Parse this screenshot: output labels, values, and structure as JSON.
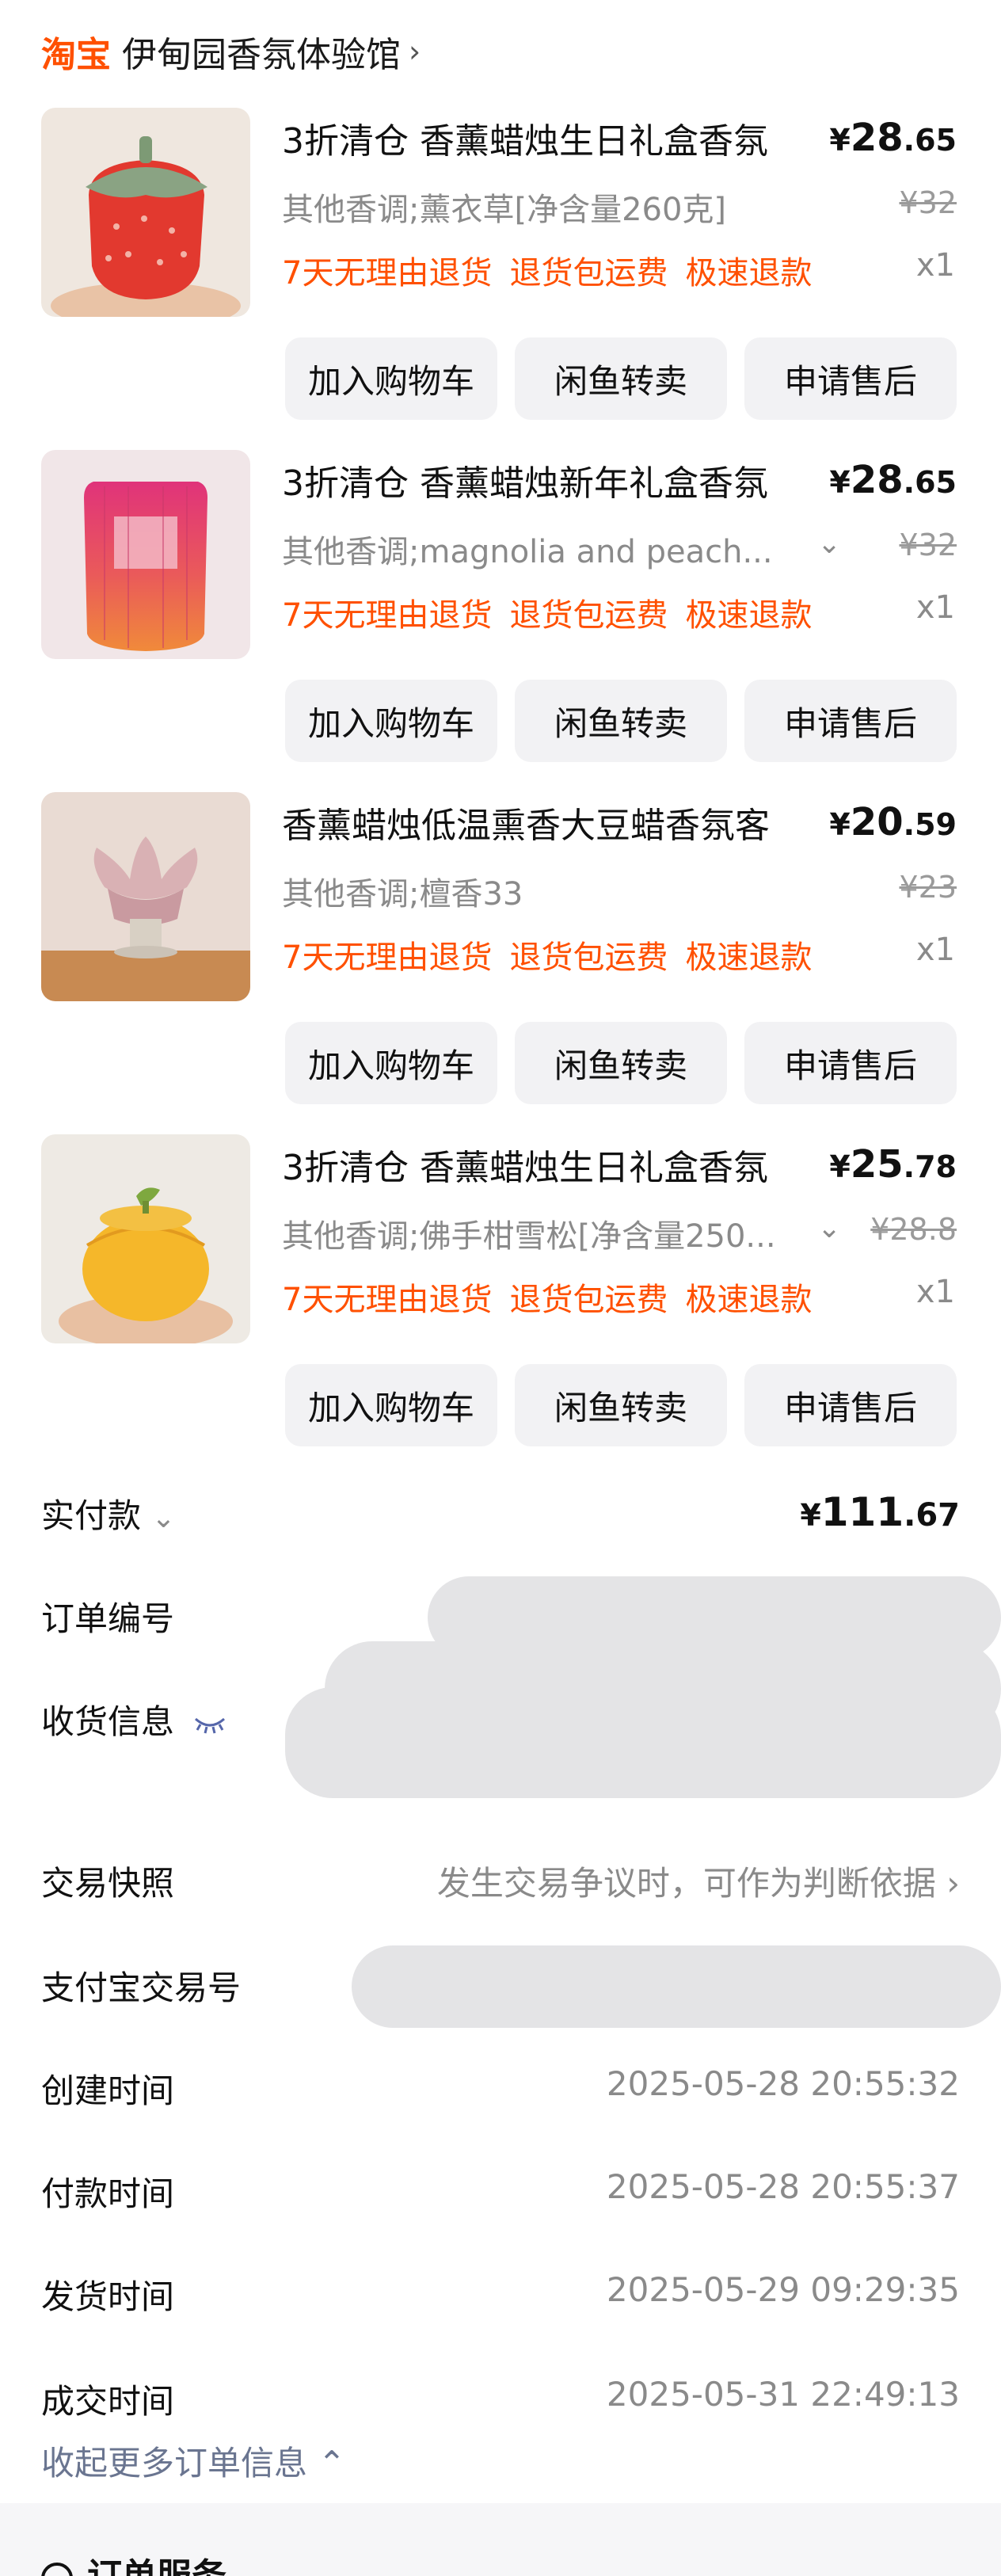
{
  "shop": {
    "brand": "淘宝",
    "name": "伊甸园香氛体验馆",
    "chevron": "›"
  },
  "items": [
    {
      "title": "3折清仓 香薰蜡烛生日礼盒香氛",
      "price_symbol": "¥",
      "price_int": "28",
      "price_dec": ".65",
      "sku": "其他香调;薰衣草[净含量260克]",
      "has_sku_chevron": false,
      "sku_chevron": "",
      "orig_price": "¥32",
      "tags": [
        "7天无理由退货",
        "退货包运费",
        "极速退款"
      ],
      "qty": "x1",
      "buttons": [
        "加入购物车",
        "闲鱼转卖",
        "申请售后"
      ]
    },
    {
      "title": "3折清仓 香薰蜡烛新年礼盒香氛",
      "price_symbol": "¥",
      "price_int": "28",
      "price_dec": ".65",
      "sku": "其他香调;magnolia and peach...",
      "has_sku_chevron": true,
      "sku_chevron": "⌄",
      "orig_price": "¥32",
      "tags": [
        "7天无理由退货",
        "退货包运费",
        "极速退款"
      ],
      "qty": "x1",
      "buttons": [
        "加入购物车",
        "闲鱼转卖",
        "申请售后"
      ]
    },
    {
      "title": "香薰蜡烛低温熏香大豆蜡香氛客",
      "price_symbol": "¥",
      "price_int": "20",
      "price_dec": ".59",
      "sku": "其他香调;檀香33",
      "has_sku_chevron": false,
      "sku_chevron": "",
      "orig_price": "¥23",
      "tags": [
        "7天无理由退货",
        "退货包运费",
        "极速退款"
      ],
      "qty": "x1",
      "buttons": [
        "加入购物车",
        "闲鱼转卖",
        "申请售后"
      ]
    },
    {
      "title": "3折清仓 香薰蜡烛生日礼盒香氛",
      "price_symbol": "¥",
      "price_int": "25",
      "price_dec": ".78",
      "sku": "其他香调;佛手柑雪松[净含量250...",
      "has_sku_chevron": true,
      "sku_chevron": "⌄",
      "orig_price": "¥28.8",
      "tags": [
        "7天无理由退货",
        "退货包运费",
        "极速退款"
      ],
      "qty": "x1",
      "buttons": [
        "加入购物车",
        "闲鱼转卖",
        "申请售后"
      ]
    }
  ],
  "summary": {
    "paid_label": "实付款",
    "paid_chevron": "⌄",
    "paid_symbol": "¥",
    "paid_int": "111",
    "paid_dec": ".67",
    "order_no_label": "订单编号",
    "shipping_label": "收货信息",
    "shipping_icon": "eye-closed-icon",
    "snapshot_label": "交易快照",
    "snapshot_value": "发生交易争议时，可作为判断依据",
    "alipay_label": "支付宝交易号",
    "created_label": "创建时间",
    "created_value": "2025-05-28 20:55:32",
    "paid_time_label": "付款时间",
    "paid_time_value": "2025-05-28 20:55:37",
    "shipped_label": "发货时间",
    "shipped_value": "2025-05-29 09:29:35",
    "closed_label": "成交时间",
    "closed_value": "2025-05-31 22:49:13",
    "collapse_label": "收起更多订单信息",
    "collapse_chevron": "⌃"
  },
  "footer": {
    "title": "订单服务"
  },
  "colors": {
    "accent": "#ff5000",
    "muted": "#8a8a8a",
    "button_bg": "#f2f2f4"
  }
}
